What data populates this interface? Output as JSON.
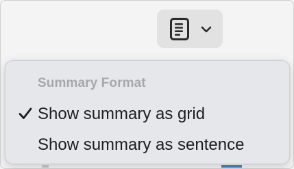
{
  "toolbar": {
    "summary_button_icon": "document-list-icon",
    "dropdown_icon": "chevron-down-icon"
  },
  "menu": {
    "header": "Summary Format",
    "items": [
      {
        "label": "Show summary as grid",
        "checked": true
      },
      {
        "label": "Show summary as sentence",
        "checked": false
      }
    ]
  }
}
